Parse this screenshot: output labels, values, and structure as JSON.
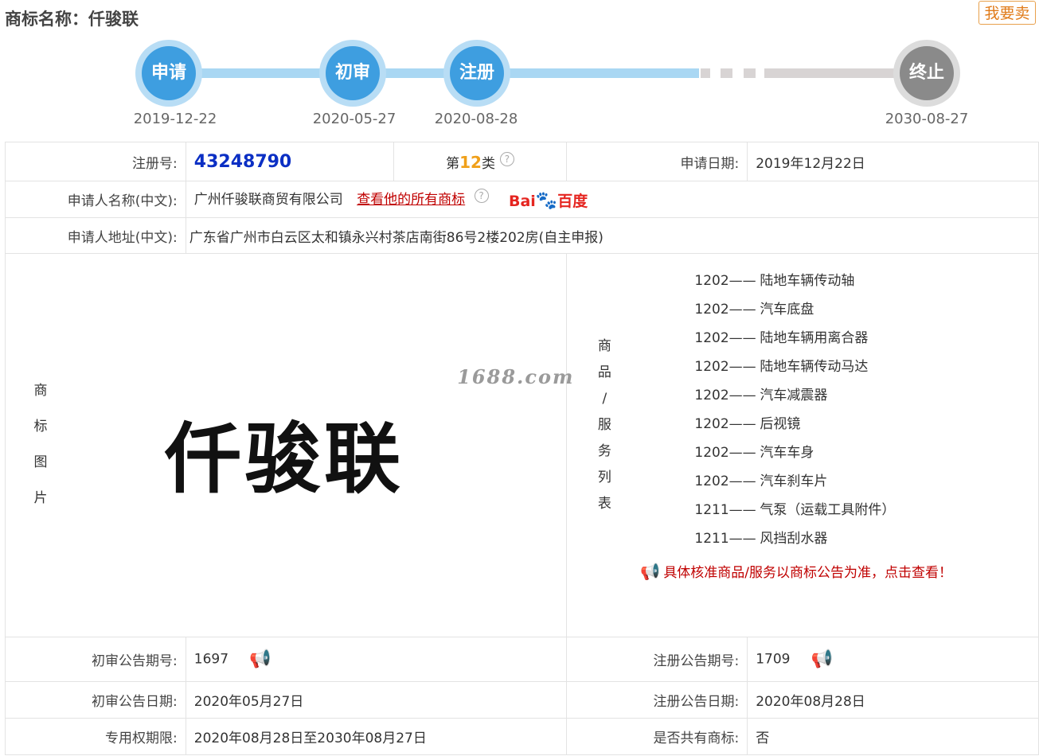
{
  "header": {
    "title": "商标名称：仟骏联",
    "sell_button": "我要卖"
  },
  "timeline": [
    {
      "label": "申请",
      "date": "2019-12-22"
    },
    {
      "label": "初审",
      "date": "2020-05-27"
    },
    {
      "label": "注册",
      "date": "2020-08-28"
    },
    {
      "label": "终止",
      "date": "2030-08-27"
    }
  ],
  "info": {
    "reg_no_label": "注册号:",
    "reg_no": "43248790",
    "class_prefix": "第",
    "class_num": "12",
    "class_suffix": "类",
    "apply_date_label": "申请日期:",
    "apply_date": "2019年12月22日",
    "applicant_label": "申请人名称(中文):",
    "applicant": "广州仟骏联商贸有限公司",
    "view_all_link": "查看他的所有商标",
    "baidu_text": "百度",
    "baidu_prefix": "Bai",
    "address_label": "申请人地址(中文):",
    "address": "广东省广州市白云区太和镇永兴村茶店南街86号2楼202房(自主申报)",
    "logo_label": [
      "商",
      "标",
      "图",
      "片"
    ],
    "logo_text": "仟骏联",
    "watermark": "1688.com",
    "goods_label": [
      "商",
      "品",
      "/",
      "服",
      "务",
      "列",
      "表"
    ],
    "goods": [
      {
        "code": "1202——",
        "name": "陆地车辆传动轴"
      },
      {
        "code": "1202——",
        "name": "汽车底盘"
      },
      {
        "code": "1202——",
        "name": "陆地车辆用离合器"
      },
      {
        "code": "1202——",
        "name": "陆地车辆传动马达"
      },
      {
        "code": "1202——",
        "name": "汽车减震器"
      },
      {
        "code": "1202——",
        "name": "后视镜"
      },
      {
        "code": "1202——",
        "name": "汽车车身"
      },
      {
        "code": "1202——",
        "name": "汽车刹车片"
      },
      {
        "code": "1211——",
        "name": "气泵（运载工具附件）"
      },
      {
        "code": "1211——",
        "name": "风挡刮水器"
      }
    ],
    "goods_notice": "具体核准商品/服务以商标公告为准，点击查看！",
    "prelim_no_label": "初审公告期号:",
    "prelim_no": "1697",
    "reg_pub_no_label": "注册公告期号:",
    "reg_pub_no": "1709",
    "prelim_date_label": "初审公告日期:",
    "prelim_date": "2020年05月27日",
    "reg_pub_date_label": "注册公告日期:",
    "reg_pub_date": "2020年08月28日",
    "exclusive_label": "专用权期限:",
    "exclusive": "2020年08月28日至2030年08月27日",
    "shared_label": "是否共有商标:",
    "shared": "否"
  }
}
